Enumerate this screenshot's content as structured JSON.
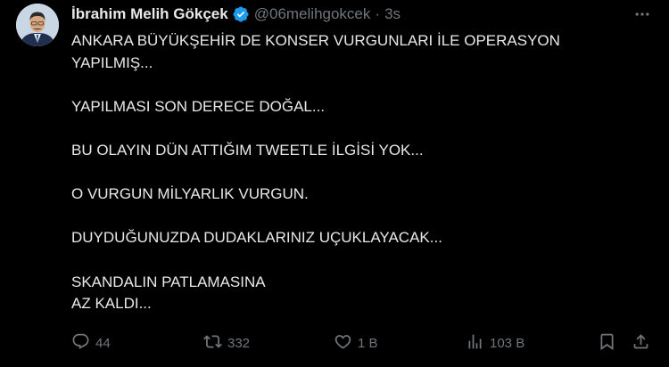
{
  "author": {
    "name": "İbrahim Melih Gökçek",
    "handle": "@06melihgokcek",
    "separator": "·",
    "timestamp": "3s",
    "verified": true,
    "verified_color": "#1d9bf0"
  },
  "tweet": {
    "lines": [
      "ANKARA BÜYÜKŞEHİR DE KONSER VURGUNLARI İLE OPERASYON YAPILMIŞ...",
      "YAPILMASI SON DERECE DOĞAL...",
      "BU OLAYIN DÜN ATTIĞIM TWEETLE İLGİSİ YOK...",
      "O VURGUN MİLYARLIK VURGUN.",
      "DUYDUĞUNUZDA DUDAKLARINIZ UÇUKLAYACAK...",
      "SKANDALIN PATLAMASINA\nAZ KALDI..."
    ]
  },
  "actions": {
    "replies": "44",
    "reposts": "332",
    "likes": "1 B",
    "views": "103 B"
  },
  "icons": {
    "more": "more-options-icon",
    "reply": "reply-icon",
    "repost": "repost-icon",
    "like": "like-icon",
    "views": "views-icon",
    "bookmark": "bookmark-icon",
    "share": "share-icon"
  },
  "colors": {
    "background": "#000000",
    "text": "#e7e9ea",
    "secondary": "#71767b"
  }
}
